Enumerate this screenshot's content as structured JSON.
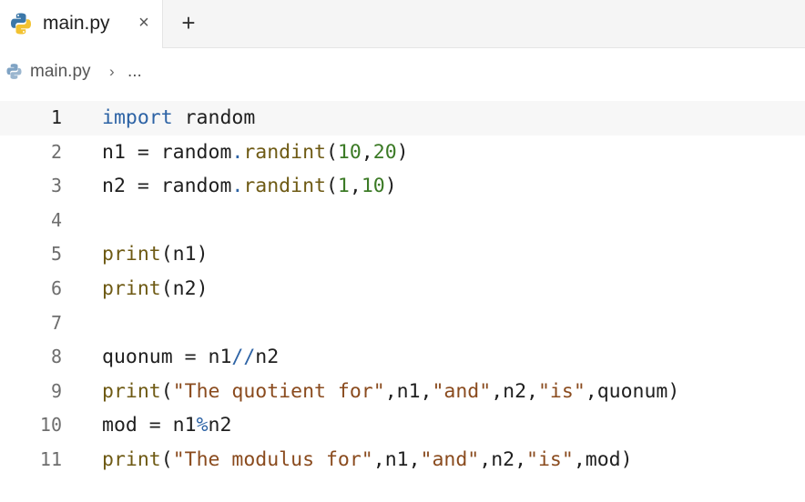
{
  "tabs": [
    {
      "label": "main.py",
      "close_glyph": "×",
      "icon": "python-icon"
    }
  ],
  "add_tab_glyph": "+",
  "breadcrumb": {
    "icon": "python-icon",
    "file": "main.py",
    "separator": "›",
    "more": "..."
  },
  "editor": {
    "current_line": 1,
    "lines": [
      {
        "number": "1",
        "tokens": [
          {
            "t": "import",
            "k": "keyword"
          },
          {
            "t": " random",
            "k": "plain"
          }
        ]
      },
      {
        "number": "2",
        "tokens": [
          {
            "t": "n1 = random",
            "k": "plain"
          },
          {
            "t": ".",
            "k": "operator"
          },
          {
            "t": "randint",
            "k": "function"
          },
          {
            "t": "(",
            "k": "plain"
          },
          {
            "t": "10",
            "k": "number"
          },
          {
            "t": ",",
            "k": "plain"
          },
          {
            "t": "20",
            "k": "number"
          },
          {
            "t": ")",
            "k": "plain"
          }
        ]
      },
      {
        "number": "3",
        "tokens": [
          {
            "t": "n2 = random",
            "k": "plain"
          },
          {
            "t": ".",
            "k": "operator"
          },
          {
            "t": "randint",
            "k": "function"
          },
          {
            "t": "(",
            "k": "plain"
          },
          {
            "t": "1",
            "k": "number"
          },
          {
            "t": ",",
            "k": "plain"
          },
          {
            "t": "10",
            "k": "number"
          },
          {
            "t": ")",
            "k": "plain"
          }
        ]
      },
      {
        "number": "4",
        "tokens": []
      },
      {
        "number": "5",
        "tokens": [
          {
            "t": "print",
            "k": "function"
          },
          {
            "t": "(n1)",
            "k": "plain"
          }
        ]
      },
      {
        "number": "6",
        "tokens": [
          {
            "t": "print",
            "k": "function"
          },
          {
            "t": "(n2)",
            "k": "plain"
          }
        ]
      },
      {
        "number": "7",
        "tokens": []
      },
      {
        "number": "8",
        "tokens": [
          {
            "t": "quonum = n1",
            "k": "plain"
          },
          {
            "t": "//",
            "k": "operator"
          },
          {
            "t": "n2",
            "k": "plain"
          }
        ]
      },
      {
        "number": "9",
        "tokens": [
          {
            "t": "print",
            "k": "function"
          },
          {
            "t": "(",
            "k": "plain"
          },
          {
            "t": "\"The quotient for\"",
            "k": "string"
          },
          {
            "t": ",n1,",
            "k": "plain"
          },
          {
            "t": "\"and\"",
            "k": "string"
          },
          {
            "t": ",n2,",
            "k": "plain"
          },
          {
            "t": "\"is\"",
            "k": "string"
          },
          {
            "t": ",quonum)",
            "k": "plain"
          }
        ]
      },
      {
        "number": "10",
        "tokens": [
          {
            "t": "mod = n1",
            "k": "plain"
          },
          {
            "t": "%",
            "k": "operator"
          },
          {
            "t": "n2",
            "k": "plain"
          }
        ]
      },
      {
        "number": "11",
        "tokens": [
          {
            "t": "print",
            "k": "function"
          },
          {
            "t": "(",
            "k": "plain"
          },
          {
            "t": "\"The modulus for\"",
            "k": "string"
          },
          {
            "t": ",n1,",
            "k": "plain"
          },
          {
            "t": "\"and\"",
            "k": "string"
          },
          {
            "t": ",n2,",
            "k": "plain"
          },
          {
            "t": "\"is\"",
            "k": "string"
          },
          {
            "t": ",mod)",
            "k": "plain"
          }
        ]
      }
    ]
  },
  "colors": {
    "keyword": "#2d63a5",
    "function": "#6e5a14",
    "number": "#3b7a25",
    "string": "#8a4b1e",
    "python_blue": "#3b77a8",
    "python_yellow": "#f2c230"
  }
}
